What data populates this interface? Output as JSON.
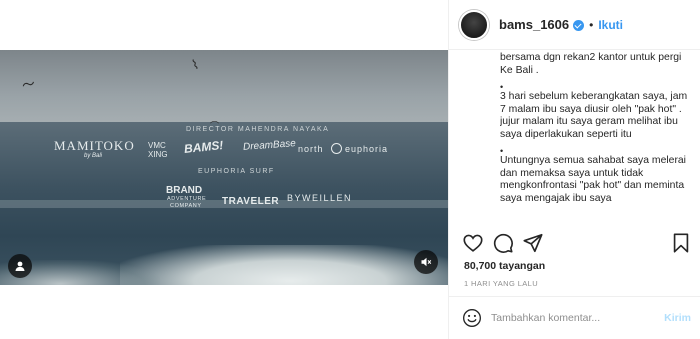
{
  "post": {
    "username": "bams_1606",
    "follow_label": "Ikuti",
    "separator": "•",
    "caption_lines": [
      "bersama dgn rekan2 kantor untuk pergi Ke Bali .",
      "3 hari sebelum keberangkatan saya, jam 7 malam ibu saya diusir oleh \"pak hot\" . jujur malam itu saya geram melihat ibu saya diperlakukan seperti itu",
      "Untungnya semua sahabat saya melerai dan memaksa saya untuk tidak mengkonfrontasi \"pak hot\" dan meminta saya mengajak ibu saya"
    ],
    "bullet": "•",
    "views": "80,700 tayangan",
    "time_ago": "1 HARI YANG LALU"
  },
  "comment": {
    "placeholder": "Tambahkan komentar...",
    "send_label": "Kirim"
  },
  "video_logos": {
    "mamitoko": "MAMITOKO",
    "mamitoko_sub": "by Bali",
    "vmc": "VMC",
    "vmc2": "XING",
    "bams": "BAMS!",
    "dreambase": "DreamBase",
    "north": "north",
    "euphoria": "euphoria",
    "credits_top": "DIRECTOR MAHENDRA NAYAKA",
    "credits_mid": "EUPHORIA SURF",
    "brand": "BRAND",
    "brand_sub": "ADVENTURE",
    "brand_sub2": "COMPANY",
    "traveler": "TRAVELER",
    "byweillen": "BYWEILLEN"
  },
  "colors": {
    "accent": "#3897f0",
    "send_disabled": "#b2dffc",
    "muted": "#8e8e8e",
    "text": "#262626"
  },
  "icons": [
    "user-tag-icon",
    "mute-icon",
    "verified-icon",
    "heart-icon",
    "comment-icon",
    "share-icon",
    "bookmark-icon",
    "emoji-icon"
  ]
}
